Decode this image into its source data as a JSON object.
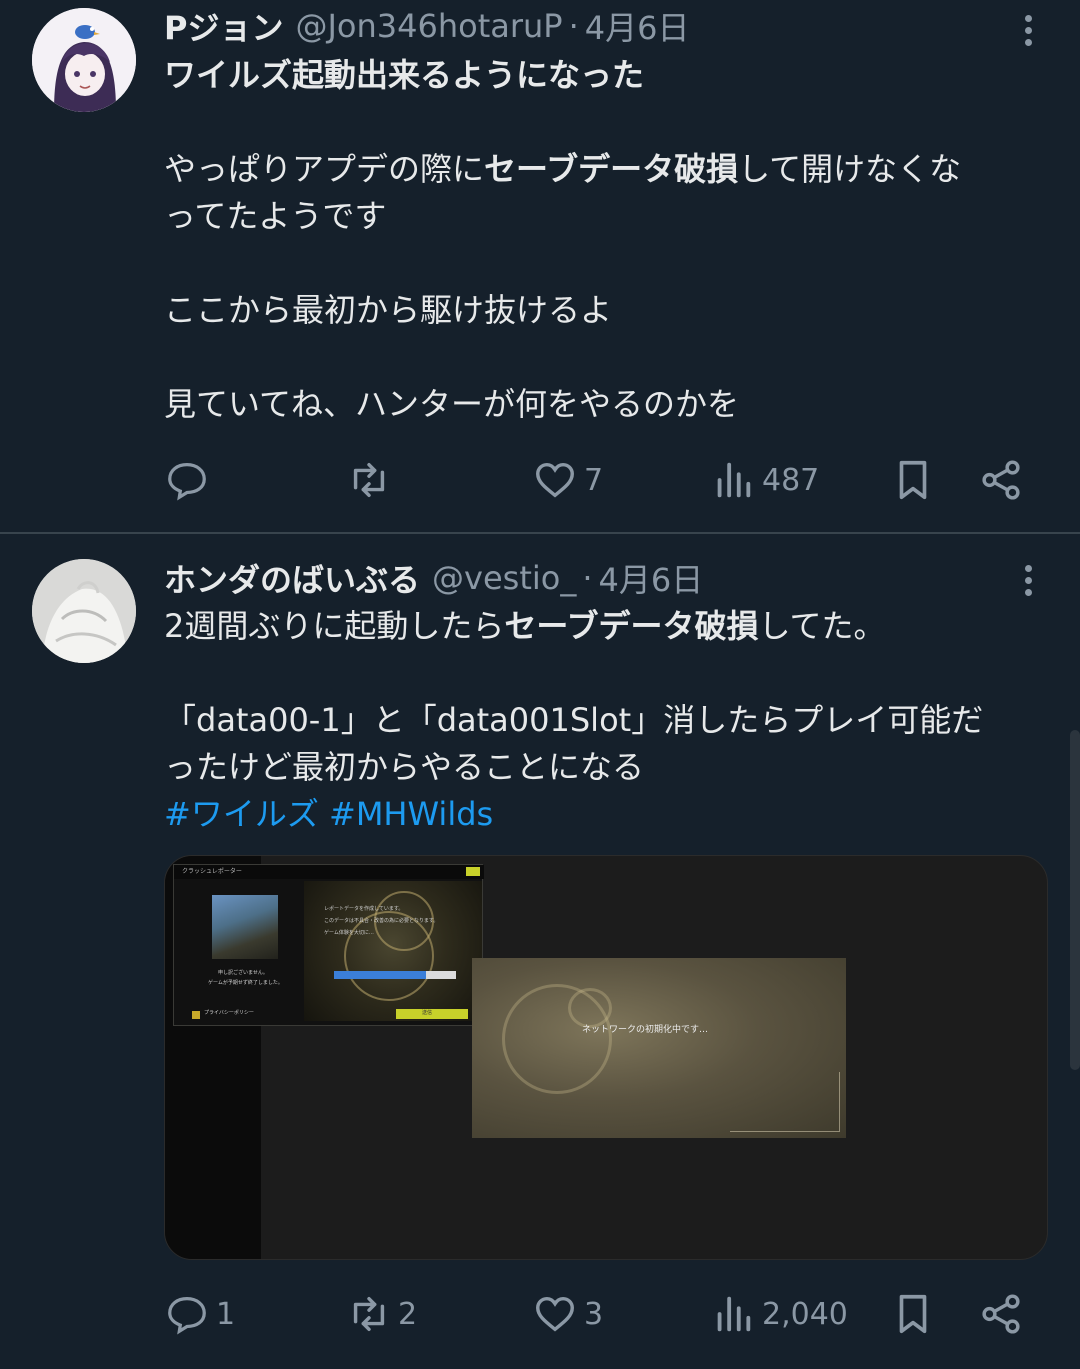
{
  "tweets": [
    {
      "name": "Pジョン",
      "handle": "@Jon346hotaruP",
      "separator": "·",
      "date": "4月6日",
      "body": {
        "line1": "ワイルズ起動出来るようになった",
        "line2a": "やっぱりアプデの際に",
        "line2b": "セーブデータ破損",
        "line2c": "して開けなくな",
        "line3": "ってたようです",
        "line4": "ここから最初から駆け抜けるよ",
        "line5": "見ていてね、ハンターが何をやるのかを"
      },
      "stats": {
        "replies": "",
        "retweets": "",
        "likes": "7",
        "views": "487"
      }
    },
    {
      "name": "ホンダのばいぶる",
      "handle": "@vestio_",
      "separator": "·",
      "date": "4月6日",
      "body": {
        "line1a": "2週間ぶりに起動したら",
        "line1b": "セーブデータ破損",
        "line1c": "してた。",
        "line2": "「data00-1」と「data001Slot」消したらプレイ可能だ",
        "line3": "ったけど最初からやることになる",
        "hashtag1": "#ワイルズ",
        "hashtag2": "#MHWilds"
      },
      "media": {
        "dialog_title": "クラッシュレポーター",
        "dialog_text1": "レポートデータを作成しています。",
        "dialog_text2": "このデータは不具合・改善の為に必要となります。",
        "dialog_text3": "ゲーム体験を大切に…",
        "dialog_left1": "申し訳ございません。",
        "dialog_left2": "ゲームが予期せず終了しました。",
        "dialog_left3": "",
        "dialog_footer": "プライバシーポリシー",
        "dialog_button": "送信",
        "loading_message": "ネットワークの初期化中です…",
        "progress": 0.75
      },
      "stats": {
        "replies": "1",
        "retweets": "2",
        "likes": "3",
        "views": "2,040"
      }
    }
  ],
  "colors": {
    "background": "#15202b",
    "text": "#e7e9ea",
    "muted": "#8b98a5",
    "link": "#1d9bf0"
  },
  "icons": [
    "reply-icon",
    "retweet-icon",
    "like-icon",
    "views-icon",
    "bookmark-icon",
    "share-icon",
    "more-icon"
  ]
}
